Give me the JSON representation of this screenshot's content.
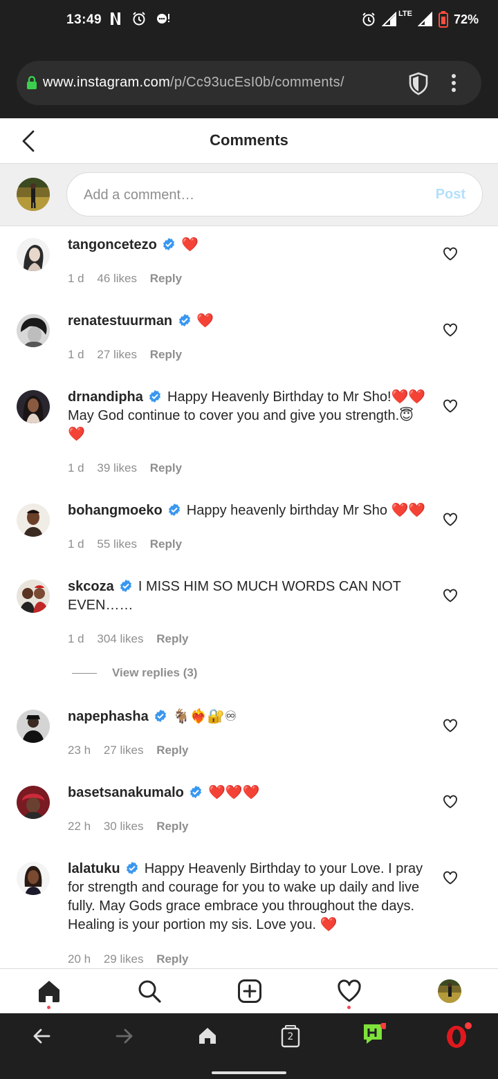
{
  "status_bar": {
    "time": "13:49",
    "battery": "72%",
    "network": "LTE"
  },
  "browser": {
    "url_host": "www.instagram.com",
    "url_path": "/p/Cc93ucEsI0b/comments/"
  },
  "header": {
    "title": "Comments"
  },
  "compose": {
    "placeholder": "Add a comment…",
    "post_label": "Post"
  },
  "comments": [
    {
      "username": "tangoncetezo",
      "text": "",
      "emoji": "❤️",
      "time": "1 d",
      "likes": "46 likes",
      "reply": "Reply"
    },
    {
      "username": "renatestuurman",
      "text": "",
      "emoji": "❤️",
      "time": "1 d",
      "likes": "27 likes",
      "reply": "Reply"
    },
    {
      "username": "drnandipha",
      "text": "Happy Heavenly Birthday to Mr Sho!❤️❤️ May God continue to cover you and give you strength.😇 ❤️",
      "emoji": "",
      "time": "1 d",
      "likes": "39 likes",
      "reply": "Reply"
    },
    {
      "username": "bohangmoeko",
      "text": "Happy heavenly birthday Mr Sho ❤️❤️",
      "emoji": "",
      "time": "1 d",
      "likes": "55 likes",
      "reply": "Reply"
    },
    {
      "username": "skcoza",
      "text": "I MISS HIM SO MUCH WORDS CAN NOT EVEN……",
      "emoji": "",
      "time": "1 d",
      "likes": "304 likes",
      "reply": "Reply"
    },
    {
      "username": "napephasha",
      "text": "",
      "emoji": "🐐❤️‍🔥🔐♾",
      "time": "23 h",
      "likes": "27 likes",
      "reply": "Reply"
    },
    {
      "username": "basetsanakumalo",
      "text": "",
      "emoji": "❤️❤️❤️",
      "time": "22 h",
      "likes": "30 likes",
      "reply": "Reply"
    },
    {
      "username": "lalatuku",
      "text": "Happy Heavenly Birthday to your Love. I pray for strength and courage for you to wake up daily and live fully. May Gods grace embrace you throughout the days. Healing is your portion my sis. Love you. ❤️",
      "emoji": "",
      "time": "20 h",
      "likes": "29 likes",
      "reply": "Reply"
    }
  ],
  "view_replies": "View replies (3)",
  "browser_nav": {
    "tabs_count": "2"
  },
  "colors": {
    "verified_blue": "#3897f0",
    "heart_red": "#ed4956",
    "post_disabled": "#b2dffc",
    "meta_gray": "#8e8e8e",
    "chrome_dark": "#1f1f1f"
  }
}
